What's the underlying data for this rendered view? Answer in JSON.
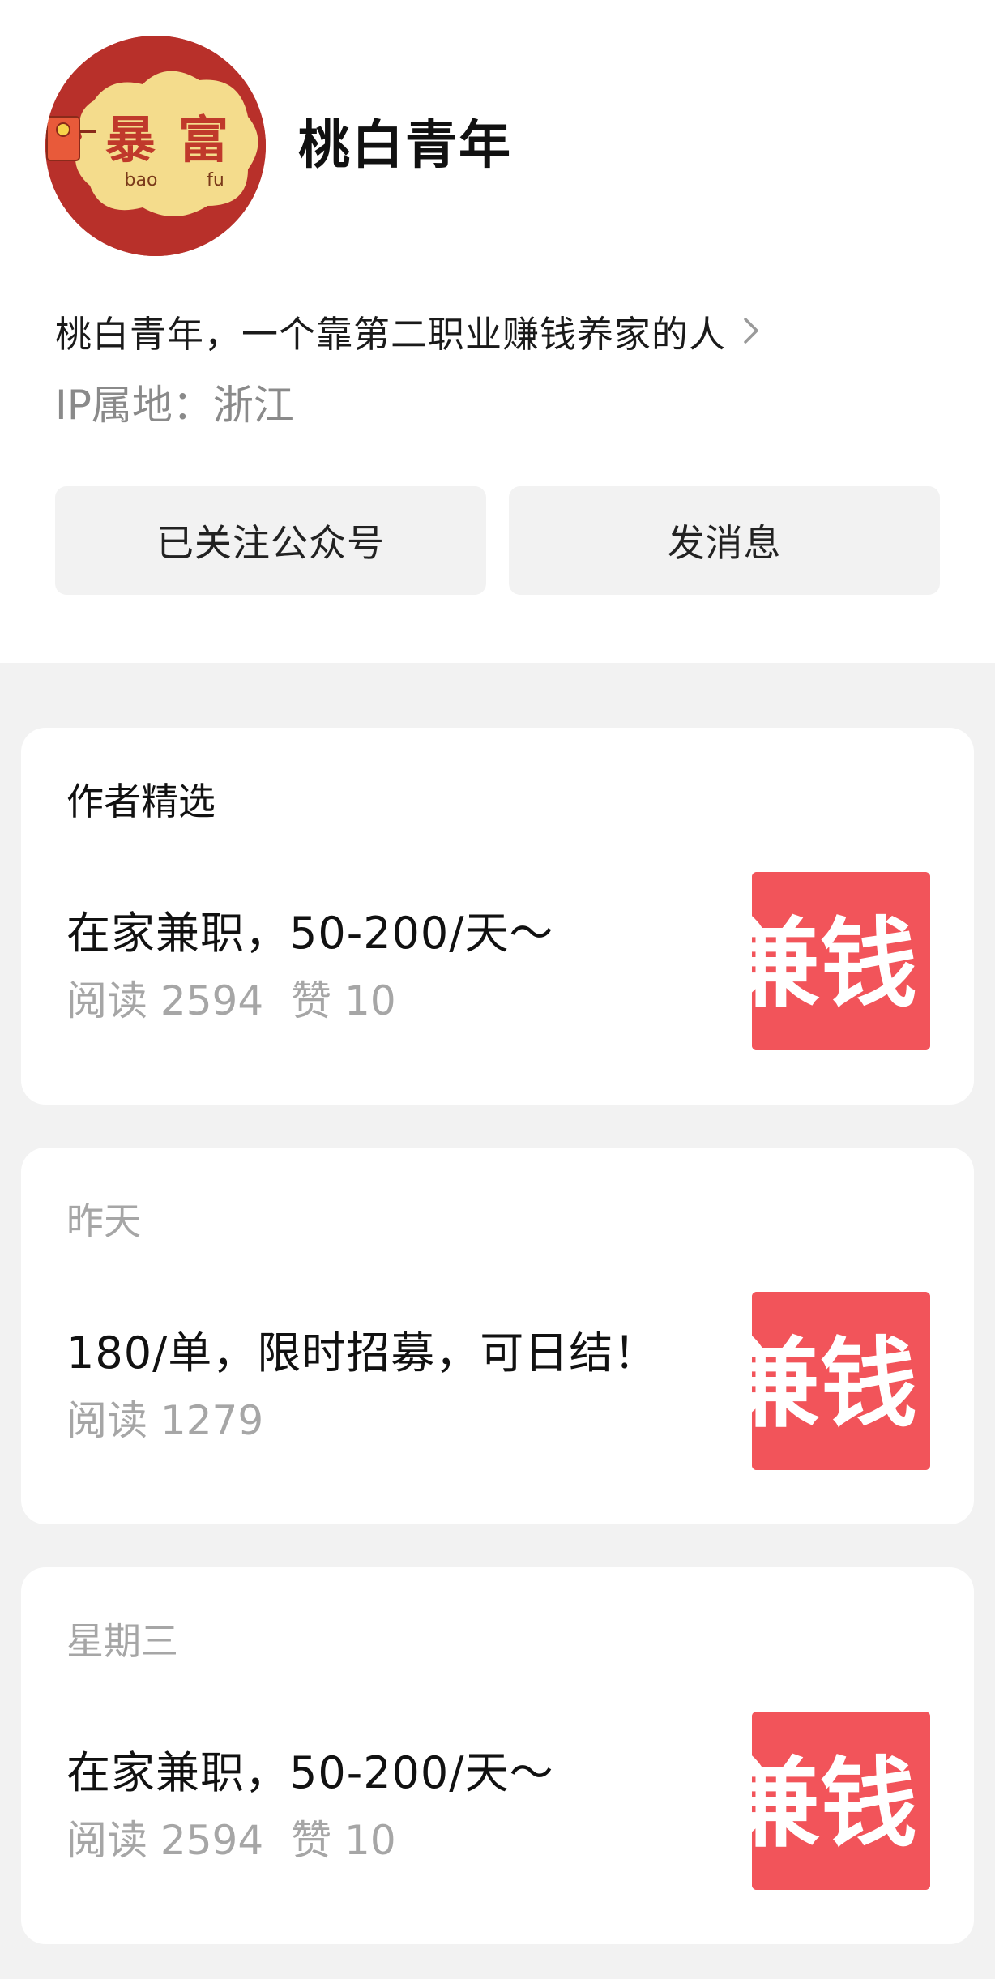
{
  "profile": {
    "avatar": {
      "char_1": "暴",
      "char_2": "富",
      "pinyin_1": "bao",
      "pinyin_2": "fu"
    },
    "account_name": "桃白青年",
    "bio": "桃白青年，一个靠第二职业赚钱养家的人",
    "ip_location": "IP属地：浙江",
    "follow_button": "已关注公众号",
    "message_button": "发消息"
  },
  "articles": [
    {
      "header": "作者精选",
      "title": "在家兼职，50-200/天～",
      "reads": "阅读 2594",
      "likes": "赞 10",
      "thumb_text": "兼钱"
    },
    {
      "header": "昨天",
      "title": "180/单，限时招募，可日结！",
      "reads": "阅读 1279",
      "thumb_text": "兼钱"
    },
    {
      "header": "星期三",
      "title": "在家兼职，50-200/天～",
      "reads": "阅读 2594",
      "likes": "赞 10",
      "thumb_text": "兼钱"
    }
  ],
  "colors": {
    "avatar_bg": "#b8302a",
    "avatar_cloud": "#f4dc8c",
    "thumb_bg": "#f2545a",
    "muted_text": "#a6a6a6",
    "button_bg": "#f2f2f2"
  }
}
